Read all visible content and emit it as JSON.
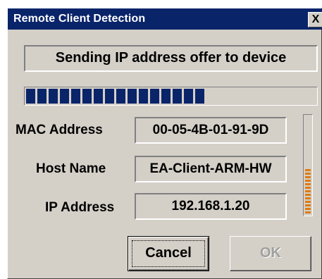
{
  "window": {
    "title": "Remote Client Detection",
    "close_symbol": "X"
  },
  "status": {
    "message": "Sending IP address offer to device"
  },
  "progress": {
    "fraction": 0.61
  },
  "activity_meter": {
    "fraction": 0.45
  },
  "fields": {
    "mac_label": "MAC Address",
    "mac_value": "00-05-4B-01-91-9D",
    "host_label": "Host Name",
    "host_value": "EA-Client-ARM-HW",
    "ip_label": "IP Address",
    "ip_value": "192.168.1.20"
  },
  "buttons": {
    "cancel_label": "Cancel",
    "ok_label": "OK",
    "ok_enabled": false
  }
}
